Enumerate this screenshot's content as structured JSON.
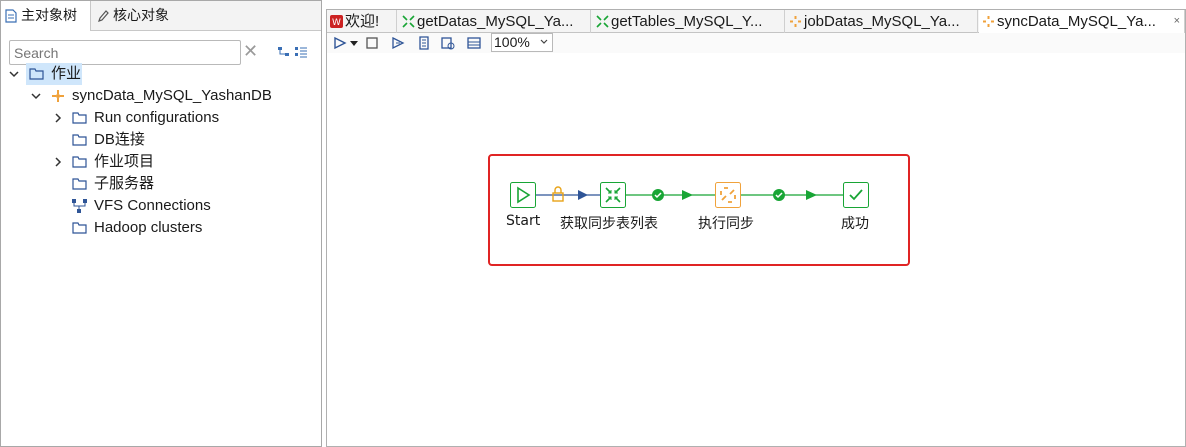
{
  "left_panel": {
    "tabs": [
      {
        "label": "主对象树",
        "icon": "document-icon"
      },
      {
        "label": "核心对象",
        "icon": "pencil-icon"
      }
    ],
    "search": {
      "placeholder": "Search",
      "value": ""
    },
    "tree": {
      "root": {
        "label": "作业",
        "icon": "folder-icon"
      },
      "job": {
        "label": "syncData_MySQL_YashanDB",
        "icon": "job-icon"
      },
      "children": [
        {
          "label": "Run configurations",
          "expandable": true
        },
        {
          "label": "DB连接",
          "expandable": false
        },
        {
          "label": "作业项目",
          "expandable": true
        },
        {
          "label": "子服务器",
          "expandable": false
        },
        {
          "label": "VFS Connections",
          "expandable": false
        },
        {
          "label": "Hadoop clusters",
          "expandable": false
        }
      ]
    }
  },
  "editor": {
    "tabs": [
      {
        "label": "欢迎!",
        "icon": "welcome-icon"
      },
      {
        "label": "getDatas_MySQL_Ya...",
        "icon": "transformation-icon"
      },
      {
        "label": "getTables_MySQL_Y...",
        "icon": "transformation-icon"
      },
      {
        "label": "jobDatas_MySQL_Ya...",
        "icon": "job-icon"
      },
      {
        "label": "syncData_MySQL_Ya...",
        "icon": "job-icon",
        "active": true,
        "close": "×"
      }
    ],
    "toolbar": {
      "zoom": "100%"
    },
    "flow": {
      "steps": [
        {
          "label": "Start",
          "icon": "play-icon"
        },
        {
          "label": "获取同步表列表",
          "icon": "transformation-icon"
        },
        {
          "label": "执行同步",
          "icon": "job-icon"
        },
        {
          "label": "成功",
          "icon": "check-icon"
        }
      ]
    }
  },
  "colors": {
    "highlight_border": "#e02424",
    "success_green": "#18a535",
    "selection_blue": "#cfe6fb",
    "link_blue": "#2f5597"
  }
}
